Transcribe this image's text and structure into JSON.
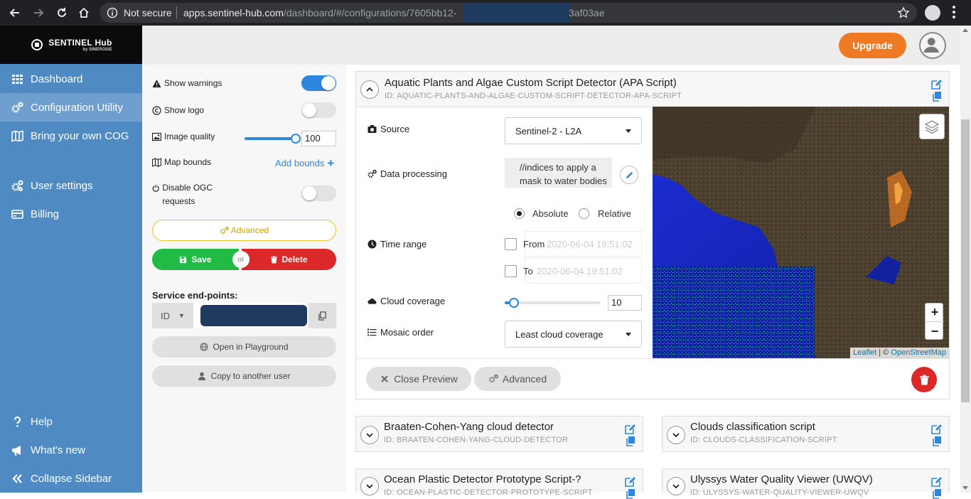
{
  "browser": {
    "not_secure": "Not secure",
    "url_host": "apps.sentinel-hub.com",
    "url_path": "/dashboard/#/configurations/7605bb12-",
    "url_tail": "3af03ae"
  },
  "logo": {
    "text": "SENTINEL Hub",
    "sub": "by SINERGISE"
  },
  "sidebar": {
    "items": [
      {
        "label": "Dashboard",
        "icon": "grid-icon"
      },
      {
        "label": "Configuration Utility",
        "icon": "gears-icon",
        "active": true
      },
      {
        "label": "Bring your own COG",
        "icon": "map-icon"
      },
      {
        "label": "User settings",
        "icon": "cogs-icon"
      },
      {
        "label": "Billing",
        "icon": "credit-card-icon"
      },
      {
        "label": "Help",
        "icon": "question-icon"
      },
      {
        "label": "What's new",
        "icon": "bullhorn-icon"
      },
      {
        "label": "Collapse Sidebar",
        "icon": "double-chevron-left-icon"
      }
    ]
  },
  "topbar": {
    "upgrade": "Upgrade"
  },
  "left_panel": {
    "show_warnings": "Show warnings",
    "show_warnings_on": true,
    "show_logo": "Show logo",
    "show_logo_on": false,
    "image_quality": "Image quality",
    "image_quality_value": "100",
    "map_bounds": "Map bounds",
    "add_bounds": "Add bounds",
    "disable_ogc": "Disable OGC requests",
    "disable_ogc_on": false,
    "advanced": "Advanced",
    "save": "Save",
    "or": "or",
    "delete": "Delete",
    "service_endpoints": "Service end-points:",
    "id_select": "ID",
    "open_playground": "Open in Playground",
    "copy_user": "Copy to another user"
  },
  "main_card": {
    "title": "Aquatic Plants and Algae Custom Script Detector (APA Script)",
    "id": "ID: AQUATIC-PLANTS-AND-ALGAE-CUSTOM-SCRIPT-DETECTOR-APA-SCRIPT",
    "source_label": "Source",
    "source_value": "Sentinel-2 - L2A",
    "data_processing_label": "Data processing",
    "data_processing_text": "//indices to apply a mask to water bodies",
    "absolute": "Absolute",
    "relative": "Relative",
    "time_range_label": "Time range",
    "from": "From",
    "from_value": "2020-06-04 19:51:02",
    "to": "To",
    "to_value": "2020-06-04 19:51:02",
    "cloud_label": "Cloud coverage",
    "cloud_value": "10",
    "mosaic_label": "Mosaic order",
    "mosaic_value": "Least cloud coverage",
    "attrib_leaflet": "Leaflet",
    "attrib_sep": " | © ",
    "attrib_osm": "OpenStreetMap",
    "close_preview": "Close Preview",
    "advanced": "Advanced",
    "zoom_in": "+",
    "zoom_out": "−"
  },
  "cards": [
    {
      "title": "Braaten-Cohen-Yang cloud detector",
      "id": "ID: BRAATEN-COHEN-YANG-CLOUD-DETECTOR"
    },
    {
      "title": "Clouds classification script",
      "id": "ID: CLOUDS-CLASSIFICATION-SCRIPT"
    },
    {
      "title": "Ocean Plastic Detector Prototype Script-?",
      "id": "ID: OCEAN-PLASTIC-DETECTOR-PROTOTYPE-SCRIPT"
    },
    {
      "title": "Ulyssys Water Quality Viewer (UWQV)",
      "id": "ID: ULYSSYS-WATER-QUALITY-VIEWER-UWQV"
    }
  ]
}
